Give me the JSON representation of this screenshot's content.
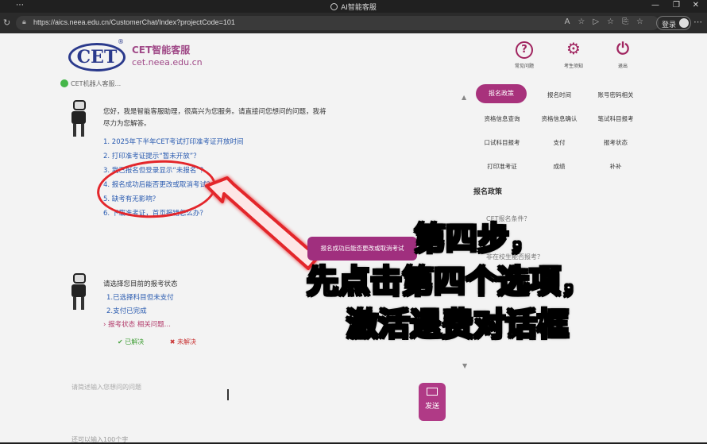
{
  "window": {
    "title": "AI智能客服"
  },
  "browser": {
    "url": "https://aics.neea.edu.cn/CustomerChat/Index?projectCode=101",
    "login_label": "登录"
  },
  "brand": {
    "logo_text": "CET",
    "title": "CET智能客服",
    "subtitle": "cet.neea.edu.cn"
  },
  "top_actions": [
    {
      "label": "常见问题",
      "glyph": "?"
    },
    {
      "label": "考生须知",
      "glyph": "⚙"
    },
    {
      "label": "退出",
      "glyph": "⏻"
    }
  ],
  "status": {
    "text": "CET机器人客服..."
  },
  "chat": {
    "greeting_line1": "您好，我是智能客服助理，很高兴为您服务。请直接问您想问的问题，我将",
    "greeting_line2": "尽力为您解答。",
    "questions": [
      "1. 2025年下半年CET考试打印准考证开放时间",
      "2. 打印准考证提示“暂未开放”？",
      "3. 我已报名但登录显示“未报名”？",
      "4. 报名成功后能否更改或取消考试？",
      "5. 缺考有无影响？",
      "6. 下载准考证，首页报错怎么办？"
    ],
    "user_bubble": "报名成功后能否更改或取消考试",
    "prompt": "请选择您目前的报考状态",
    "options": [
      "1.已选择科目但未支付",
      "2.支付已完成"
    ],
    "option_more": "› 报考状态 相关问题...",
    "feedback_yes": "✔ 已解决",
    "feedback_no": "✖ 未解决"
  },
  "input": {
    "placeholder": "请简述输入您想问的问题",
    "send_label": "发送",
    "counter": "还可以输入100个字"
  },
  "tabs": {
    "row1": [
      "报名政策",
      "报名时间",
      "账号密码相关"
    ],
    "row2": [
      "资格信息查询",
      "资格信息确认",
      "笔试科目报考"
    ],
    "row3": [
      "口试科目报考",
      "支付",
      "报考状态"
    ],
    "row4": [
      "打印准考证",
      "成绩",
      "补补"
    ]
  },
  "policy": {
    "title": "报名政策",
    "faded_1": "CET报名条件？",
    "faded_2": "非在校生能否报考？"
  },
  "overlay": {
    "line1": "第四步，",
    "line2": "先点击第四个选项，",
    "line3": "激活退费对话框"
  },
  "colors": {
    "accent": "#a8327c",
    "annotation": "#e3262b",
    "link": "#2a5bb0"
  }
}
